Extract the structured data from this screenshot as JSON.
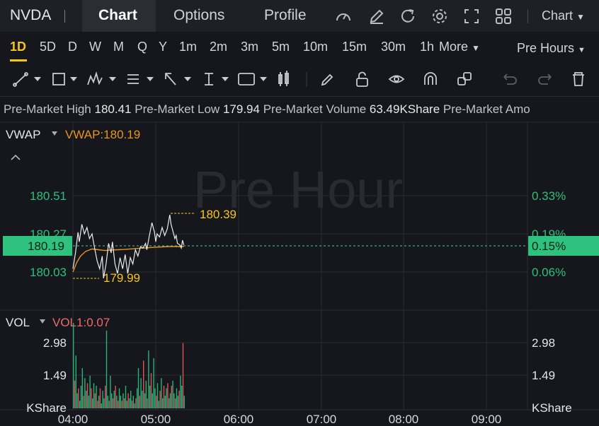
{
  "header": {
    "ticker": "NVDA",
    "tabs": [
      {
        "label": "Chart"
      },
      {
        "label": "Options"
      },
      {
        "label": "Profile"
      }
    ],
    "chart_type_label": "Chart"
  },
  "periods": {
    "items": [
      "1D",
      "5D",
      "D",
      "W",
      "M",
      "Q",
      "Y",
      "1m",
      "2m",
      "3m",
      "5m",
      "10m",
      "15m",
      "30m",
      "1h"
    ],
    "more_label": "More",
    "session_label": "Pre Hours"
  },
  "info_strip": {
    "items": [
      {
        "label": "Pre-Market High",
        "value": "180.41"
      },
      {
        "label": "Pre-Market Low",
        "value": "179.94"
      },
      {
        "label": "Pre-Market Volume",
        "value": "63.49KShare"
      },
      {
        "label": "Pre-Market Amo",
        "value": ""
      }
    ]
  },
  "price_panel": {
    "indicator_name": "VWAP",
    "indicator_value": "VWAP:180.19",
    "watermark": "Pre Hour",
    "left_ticks": [
      "180.51",
      "180.27",
      "180.03"
    ],
    "right_ticks": [
      "0.33%",
      "0.19%",
      "0.06%"
    ],
    "current_price": "180.19",
    "current_pct": "0.15%",
    "high_marker": "180.39",
    "low_marker": "179.99"
  },
  "volume_panel": {
    "indicator_name": "VOL",
    "indicator_value": "VOL1:0.07",
    "left_ticks": [
      "2.98",
      "1.49",
      "KShare"
    ],
    "right_ticks": [
      "2.98",
      "1.49",
      "KShare"
    ]
  },
  "time_axis": [
    "04:00",
    "05:00",
    "06:00",
    "07:00",
    "08:00",
    "09:00"
  ],
  "colors": {
    "accent": "#f5c518",
    "up": "#26b37a",
    "down": "#e0525a",
    "vwap": "#e8951e",
    "price_line": "#e9e9e9",
    "vol_label": "#f06a6a"
  },
  "chart_data": {
    "type": "line",
    "price_ylim": [
      179.94,
      180.58
    ],
    "price": [
      [
        0,
        180.05
      ],
      [
        2,
        180.15
      ],
      [
        4,
        180.28
      ],
      [
        5,
        180.22
      ],
      [
        7,
        180.33
      ],
      [
        9,
        180.27
      ],
      [
        11,
        180.31
      ],
      [
        13,
        180.24
      ],
      [
        15,
        180.27
      ],
      [
        17,
        180.18
      ],
      [
        19,
        180.1
      ],
      [
        21,
        180.05
      ],
      [
        23,
        180.13
      ],
      [
        24,
        179.99
      ],
      [
        26,
        180.08
      ],
      [
        28,
        180.21
      ],
      [
        30,
        180.15
      ],
      [
        31,
        180.22
      ],
      [
        33,
        180.08
      ],
      [
        35,
        180.02
      ],
      [
        37,
        180.12
      ],
      [
        39,
        180.05
      ],
      [
        41,
        180.14
      ],
      [
        43,
        180.02
      ],
      [
        45,
        180.12
      ],
      [
        47,
        180.08
      ],
      [
        49,
        180.17
      ],
      [
        51,
        180.13
      ],
      [
        53,
        180.19
      ],
      [
        55,
        180.18
      ],
      [
        57,
        180.21
      ],
      [
        58,
        180.17
      ],
      [
        60,
        180.26
      ],
      [
        62,
        180.34
      ],
      [
        64,
        180.28
      ],
      [
        65,
        180.22
      ],
      [
        66,
        180.27
      ],
      [
        68,
        180.25
      ],
      [
        70,
        180.31
      ],
      [
        72,
        180.26
      ],
      [
        74,
        180.3
      ],
      [
        76,
        180.39
      ],
      [
        77,
        180.33
      ],
      [
        78,
        180.3
      ],
      [
        80,
        180.24
      ],
      [
        81,
        180.26
      ],
      [
        82,
        180.21
      ],
      [
        84,
        180.2
      ],
      [
        85,
        180.18
      ],
      [
        86,
        180.23
      ],
      [
        87,
        180.2
      ]
    ],
    "vwap": [
      [
        0,
        180.03
      ],
      [
        3,
        180.09
      ],
      [
        6,
        180.13
      ],
      [
        10,
        180.16
      ],
      [
        15,
        180.175
      ],
      [
        20,
        180.17
      ],
      [
        25,
        180.165
      ],
      [
        30,
        180.168
      ],
      [
        35,
        180.17
      ],
      [
        40,
        180.172
      ],
      [
        45,
        180.175
      ],
      [
        50,
        180.178
      ],
      [
        55,
        180.18
      ],
      [
        60,
        180.183
      ],
      [
        65,
        180.186
      ],
      [
        70,
        180.188
      ],
      [
        75,
        180.19
      ],
      [
        80,
        180.19
      ],
      [
        87,
        180.19
      ]
    ],
    "volume_ylim": [
      0,
      3.6
    ],
    "volume": [
      [
        0,
        3.4,
        "up"
      ],
      [
        1,
        1.1,
        "down"
      ],
      [
        2,
        2.1,
        "up"
      ],
      [
        3,
        0.6,
        "up"
      ],
      [
        4,
        0.8,
        "down"
      ],
      [
        5,
        0.3,
        "up"
      ],
      [
        6,
        0.9,
        "up"
      ],
      [
        7,
        1.6,
        "up"
      ],
      [
        8,
        0.5,
        "down"
      ],
      [
        9,
        1.2,
        "up"
      ],
      [
        10,
        0.7,
        "up"
      ],
      [
        11,
        1.0,
        "down"
      ],
      [
        12,
        0.5,
        "up"
      ],
      [
        13,
        1.3,
        "up"
      ],
      [
        14,
        0.8,
        "down"
      ],
      [
        15,
        0.4,
        "up"
      ],
      [
        16,
        1.0,
        "up"
      ],
      [
        17,
        0.6,
        "down"
      ],
      [
        18,
        0.9,
        "up"
      ],
      [
        19,
        0.3,
        "down"
      ],
      [
        20,
        0.5,
        "up"
      ],
      [
        21,
        0.8,
        "down"
      ],
      [
        22,
        0.2,
        "up"
      ],
      [
        23,
        0.7,
        "up"
      ],
      [
        24,
        0.4,
        "up"
      ],
      [
        25,
        0.9,
        "down"
      ],
      [
        26,
        3.1,
        "up"
      ],
      [
        27,
        0.5,
        "up"
      ],
      [
        28,
        0.3,
        "down"
      ],
      [
        29,
        1.3,
        "up"
      ],
      [
        30,
        0.6,
        "up"
      ],
      [
        31,
        0.4,
        "down"
      ],
      [
        32,
        0.7,
        "up"
      ],
      [
        33,
        0.9,
        "down"
      ],
      [
        34,
        0.5,
        "up"
      ],
      [
        35,
        0.3,
        "down"
      ],
      [
        36,
        0.8,
        "up"
      ],
      [
        37,
        0.5,
        "up"
      ],
      [
        38,
        0.3,
        "down"
      ],
      [
        39,
        0.6,
        "up"
      ],
      [
        40,
        0.4,
        "down"
      ],
      [
        41,
        0.9,
        "up"
      ],
      [
        42,
        0.3,
        "up"
      ],
      [
        43,
        0.6,
        "down"
      ],
      [
        44,
        0.4,
        "up"
      ],
      [
        45,
        0.7,
        "up"
      ],
      [
        46,
        0.3,
        "down"
      ],
      [
        47,
        0.5,
        "up"
      ],
      [
        48,
        0.2,
        "up"
      ],
      [
        49,
        0.4,
        "down"
      ],
      [
        50,
        0.8,
        "up"
      ],
      [
        51,
        1.6,
        "up"
      ],
      [
        52,
        0.5,
        "down"
      ],
      [
        53,
        1.2,
        "up"
      ],
      [
        54,
        0.7,
        "up"
      ],
      [
        55,
        1.9,
        "down"
      ],
      [
        56,
        0.6,
        "up"
      ],
      [
        57,
        1.1,
        "up"
      ],
      [
        58,
        0.4,
        "down"
      ],
      [
        59,
        2.3,
        "up"
      ],
      [
        60,
        0.9,
        "up"
      ],
      [
        61,
        1.4,
        "down"
      ],
      [
        62,
        0.6,
        "up"
      ],
      [
        63,
        2.0,
        "up"
      ],
      [
        64,
        0.8,
        "up"
      ],
      [
        65,
        0.5,
        "down"
      ],
      [
        66,
        1.0,
        "up"
      ],
      [
        67,
        0.3,
        "up"
      ],
      [
        68,
        0.7,
        "down"
      ],
      [
        69,
        1.2,
        "up"
      ],
      [
        70,
        0.4,
        "up"
      ],
      [
        71,
        0.9,
        "down"
      ],
      [
        72,
        0.5,
        "up"
      ],
      [
        73,
        0.8,
        "up"
      ],
      [
        74,
        1.0,
        "down"
      ],
      [
        75,
        0.4,
        "up"
      ],
      [
        76,
        0.6,
        "up"
      ],
      [
        77,
        0.9,
        "down"
      ],
      [
        78,
        1.1,
        "up"
      ],
      [
        79,
        0.6,
        "up"
      ],
      [
        80,
        0.4,
        "down"
      ],
      [
        81,
        0.8,
        "up"
      ],
      [
        82,
        0.5,
        "up"
      ],
      [
        83,
        0.7,
        "down"
      ],
      [
        84,
        1.3,
        "up"
      ],
      [
        85,
        0.9,
        "up"
      ],
      [
        86,
        2.6,
        "down"
      ],
      [
        87,
        0.5,
        "up"
      ]
    ]
  }
}
